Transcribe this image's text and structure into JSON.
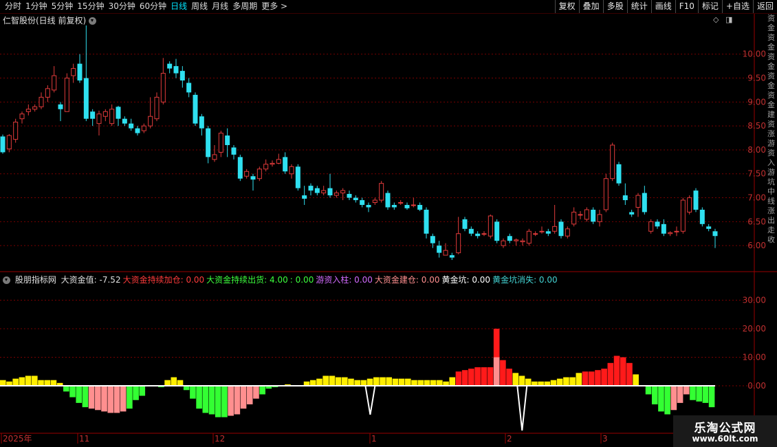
{
  "toolbar": {
    "periods": [
      "分时",
      "1分钟",
      "5分钟",
      "15分钟",
      "30分钟",
      "60分钟",
      "日线",
      "周线",
      "月线",
      "多周期",
      "更多 >"
    ],
    "active_period": "日线",
    "buttons": [
      "复权",
      "叠加",
      "多股",
      "统计",
      "画线",
      "F10",
      "标记",
      "+自选",
      "返回"
    ]
  },
  "main": {
    "title": "仁智股份(日线 前复权)",
    "price_ticks": [
      "10.00",
      "9.50",
      "9.00",
      "8.50",
      "8.00",
      "7.50",
      "7.00",
      "6.50",
      "6.00"
    ],
    "colors": {
      "up": "#e23b3b",
      "down": "#2fe0f0",
      "grid": "#7a0000",
      "axis": "#9a0000"
    }
  },
  "indicator": {
    "name": "股朋指标网",
    "items": [
      {
        "label": "大资金值:",
        "value": "-7.52",
        "color": "#e0e0e0"
      },
      {
        "label": "大资金持续加仓:",
        "value": "0.00",
        "color": "#ff3b3b"
      },
      {
        "label": "大资金持续出货:",
        "value": "4.00",
        "color": "#3dff3d"
      },
      {
        "label": ":",
        "value": "0.00",
        "color": "#3dff3d"
      },
      {
        "label": "游资入柱:",
        "value": "0.00",
        "color": "#d36bff"
      },
      {
        "label": "大资金建仓:",
        "value": "0.00",
        "color": "#ff8f8f"
      },
      {
        "label": "黄金坑:",
        "value": "0.00",
        "color": "#ffffff"
      },
      {
        "label": "黄金坑消失:",
        "value": "0.00",
        "color": "#43d3d3"
      }
    ],
    "y_ticks": [
      "30.00",
      "20.00",
      "10.00",
      "0.00"
    ]
  },
  "date_axis": [
    "2025年",
    "11",
    "12",
    "1",
    "2",
    "3"
  ],
  "right_strip": "资金资金资金资金资金建资涨游资入游坑中线涨出走收",
  "watermark": {
    "line1": "乐淘公式网",
    "line2": "www.60lt.com"
  },
  "chart_data": {
    "type": "candlestick",
    "y_range": [
      5.6,
      10.7
    ],
    "candles": [
      [
        8.28,
        7.95,
        8.32,
        7.92
      ],
      [
        8.02,
        8.3,
        8.33,
        7.95
      ],
      [
        8.22,
        8.58,
        8.65,
        8.15
      ],
      [
        8.65,
        8.75,
        8.8,
        8.55
      ],
      [
        8.8,
        8.85,
        8.95,
        8.72
      ],
      [
        8.85,
        8.9,
        8.95,
        8.8
      ],
      [
        8.9,
        9.1,
        9.2,
        8.85
      ],
      [
        9.1,
        9.28,
        9.35,
        9.0
      ],
      [
        9.25,
        9.55,
        9.75,
        9.2
      ],
      [
        8.95,
        8.85,
        9.0,
        8.6
      ],
      [
        8.8,
        9.5,
        9.6,
        8.8
      ],
      [
        9.55,
        9.7,
        9.8,
        9.4
      ],
      [
        9.8,
        9.45,
        10.0,
        9.4
      ],
      [
        9.5,
        8.65,
        10.6,
        8.6
      ],
      [
        8.8,
        8.65,
        8.85,
        8.5
      ],
      [
        8.55,
        8.75,
        8.82,
        8.3
      ],
      [
        8.7,
        8.8,
        8.85,
        8.6
      ],
      [
        8.55,
        8.85,
        8.95,
        8.5
      ],
      [
        8.9,
        8.65,
        8.92,
        8.5
      ],
      [
        8.65,
        8.55,
        8.7,
        8.5
      ],
      [
        8.55,
        8.45,
        8.65,
        8.4
      ],
      [
        8.45,
        8.35,
        8.5,
        8.3
      ],
      [
        8.4,
        8.5,
        8.55,
        8.35
      ],
      [
        8.5,
        8.7,
        9.1,
        8.45
      ],
      [
        8.65,
        9.1,
        9.2,
        8.6
      ],
      [
        9.0,
        9.6,
        9.92,
        8.95
      ],
      [
        9.8,
        9.7,
        9.85,
        9.6
      ],
      [
        9.75,
        9.6,
        9.9,
        9.5
      ],
      [
        9.65,
        9.45,
        9.75,
        9.3
      ],
      [
        9.4,
        9.2,
        9.5,
        9.1
      ],
      [
        9.15,
        8.55,
        9.2,
        8.5
      ],
      [
        8.7,
        8.45,
        8.75,
        8.3
      ],
      [
        8.45,
        7.85,
        8.5,
        7.72
      ],
      [
        7.8,
        7.9,
        8.1,
        7.75
      ],
      [
        7.95,
        8.35,
        8.4,
        7.85
      ],
      [
        8.3,
        8.1,
        8.45,
        7.85
      ],
      [
        8.05,
        7.9,
        8.1,
        7.8
      ],
      [
        7.85,
        7.4,
        7.9,
        7.35
      ],
      [
        7.45,
        7.55,
        7.6,
        7.4
      ],
      [
        7.45,
        7.38,
        7.5,
        7.15
      ],
      [
        7.4,
        7.6,
        7.65,
        7.35
      ],
      [
        7.6,
        7.7,
        7.8,
        7.55
      ],
      [
        7.7,
        7.72,
        7.78,
        7.65
      ],
      [
        7.72,
        7.8,
        7.92,
        7.7
      ],
      [
        7.85,
        7.55,
        7.95,
        7.5
      ],
      [
        7.5,
        7.65,
        7.7,
        7.4
      ],
      [
        7.65,
        7.2,
        7.7,
        7.15
      ],
      [
        7.05,
        6.98,
        7.25,
        6.85
      ],
      [
        7.25,
        7.15,
        7.3,
        7.05
      ],
      [
        7.2,
        7.1,
        7.25,
        7.05
      ],
      [
        7.1,
        7.15,
        7.25,
        7.05
      ],
      [
        7.2,
        7.05,
        7.5,
        7.0
      ],
      [
        7.05,
        7.1,
        7.15,
        7.0
      ],
      [
        7.1,
        7.15,
        7.2,
        6.95
      ],
      [
        7.08,
        7.0,
        7.15,
        6.95
      ],
      [
        7.0,
        6.95,
        7.05,
        6.9
      ],
      [
        6.95,
        6.85,
        7.0,
        6.8
      ],
      [
        6.85,
        6.8,
        6.9,
        6.7
      ],
      [
        6.9,
        6.95,
        7.0,
        6.85
      ],
      [
        6.95,
        7.3,
        7.35,
        6.9
      ],
      [
        7.1,
        6.8,
        7.15,
        6.75
      ],
      [
        6.85,
        6.8,
        6.9,
        6.75
      ],
      [
        6.9,
        6.9,
        6.95,
        6.85
      ],
      [
        6.85,
        6.78,
        6.9,
        6.75
      ],
      [
        6.85,
        6.85,
        7.0,
        6.8
      ],
      [
        6.85,
        6.75,
        6.9,
        6.72
      ],
      [
        6.75,
        6.25,
        6.8,
        6.15
      ],
      [
        6.2,
        6.05,
        6.25,
        5.95
      ],
      [
        6.0,
        5.85,
        6.1,
        5.75
      ],
      [
        5.8,
        5.9,
        6.05,
        5.8
      ],
      [
        5.8,
        5.75,
        5.85,
        5.7
      ],
      [
        5.85,
        6.25,
        6.6,
        5.82
      ],
      [
        6.55,
        6.35,
        6.6,
        6.3
      ],
      [
        6.35,
        6.25,
        6.4,
        6.2
      ],
      [
        6.25,
        6.2,
        6.3,
        6.15
      ],
      [
        6.25,
        6.25,
        6.3,
        6.2
      ],
      [
        6.2,
        6.62,
        6.65,
        6.15
      ],
      [
        6.5,
        6.1,
        6.55,
        6.05
      ],
      [
        6.0,
        6.1,
        6.15,
        5.95
      ],
      [
        6.2,
        6.1,
        6.25,
        6.05
      ],
      [
        6.1,
        6.12,
        6.15,
        6.0
      ],
      [
        6.08,
        6.1,
        6.15,
        6.0
      ],
      [
        6.05,
        6.3,
        6.35,
        6.0
      ],
      [
        6.25,
        6.25,
        6.3,
        6.2
      ],
      [
        6.3,
        6.3,
        6.4,
        6.25
      ],
      [
        6.3,
        6.25,
        6.35,
        6.2
      ],
      [
        6.3,
        6.4,
        6.85,
        6.25
      ],
      [
        6.5,
        6.2,
        6.55,
        6.15
      ],
      [
        6.2,
        6.35,
        6.4,
        6.15
      ],
      [
        6.45,
        6.7,
        6.8,
        6.4
      ],
      [
        6.65,
        6.65,
        6.72,
        6.55
      ],
      [
        6.55,
        6.75,
        6.8,
        6.5
      ],
      [
        6.75,
        6.5,
        6.8,
        6.45
      ],
      [
        6.5,
        6.65,
        6.75,
        6.4
      ],
      [
        6.75,
        7.4,
        7.5,
        6.7
      ],
      [
        7.4,
        8.1,
        8.15,
        7.35
      ],
      [
        7.7,
        7.3,
        7.75,
        7.25
      ],
      [
        7.05,
        6.95,
        7.3,
        6.85
      ],
      [
        6.7,
        6.65,
        6.75,
        6.6
      ],
      [
        6.8,
        7.05,
        7.1,
        6.6
      ],
      [
        7.1,
        6.7,
        7.25,
        6.65
      ],
      [
        6.3,
        6.5,
        6.55,
        6.25
      ],
      [
        6.5,
        6.4,
        6.55,
        6.35
      ],
      [
        6.45,
        6.25,
        6.55,
        6.2
      ],
      [
        6.25,
        6.27,
        6.3,
        6.2
      ],
      [
        6.3,
        6.3,
        6.4,
        6.2
      ],
      [
        6.3,
        6.95,
        7.0,
        6.25
      ],
      [
        6.7,
        7.0,
        7.05,
        6.65
      ],
      [
        7.15,
        6.75,
        7.2,
        6.7
      ],
      [
        6.75,
        6.45,
        6.8,
        6.4
      ],
      [
        6.4,
        6.35,
        6.45,
        6.3
      ],
      [
        6.3,
        6.2,
        6.35,
        5.95
      ]
    ],
    "histogram": [
      2,
      1.5,
      2.5,
      3,
      3.5,
      3.5,
      2,
      2,
      2,
      1,
      -2,
      -4,
      -6,
      -7.5,
      -8,
      -8.5,
      -9,
      -9.5,
      -9.5,
      -9,
      -8,
      -5,
      -3.5,
      0,
      0,
      -0.5,
      2,
      3,
      2,
      -1.5,
      -4.5,
      -8,
      -9.5,
      -10,
      -11,
      -11,
      -10.5,
      -10,
      -8,
      -6.5,
      -4.5,
      -3,
      -1,
      -0.5,
      0,
      0.5,
      0,
      0,
      1.5,
      2,
      2.5,
      3.5,
      3.5,
      3,
      3,
      2.5,
      2,
      2,
      2.5,
      3,
      3,
      3,
      2.5,
      2.5,
      2.5,
      2,
      2,
      2,
      2,
      2,
      1.5,
      3,
      5,
      5.5,
      6,
      6.5,
      6.5,
      6.5,
      20,
      9,
      6,
      4.5,
      3.5,
      2.5,
      1.5,
      1.5,
      1.5,
      2,
      2.5,
      3,
      3,
      4.5,
      5,
      5,
      5.5,
      6,
      8,
      10.5,
      10,
      8,
      4,
      0,
      -3,
      -6.5,
      -9,
      -10,
      -8.5,
      -6,
      -3,
      -5,
      -5.5,
      -6,
      -7.5
    ],
    "gold_pit_markers": [
      58,
      82
    ]
  }
}
